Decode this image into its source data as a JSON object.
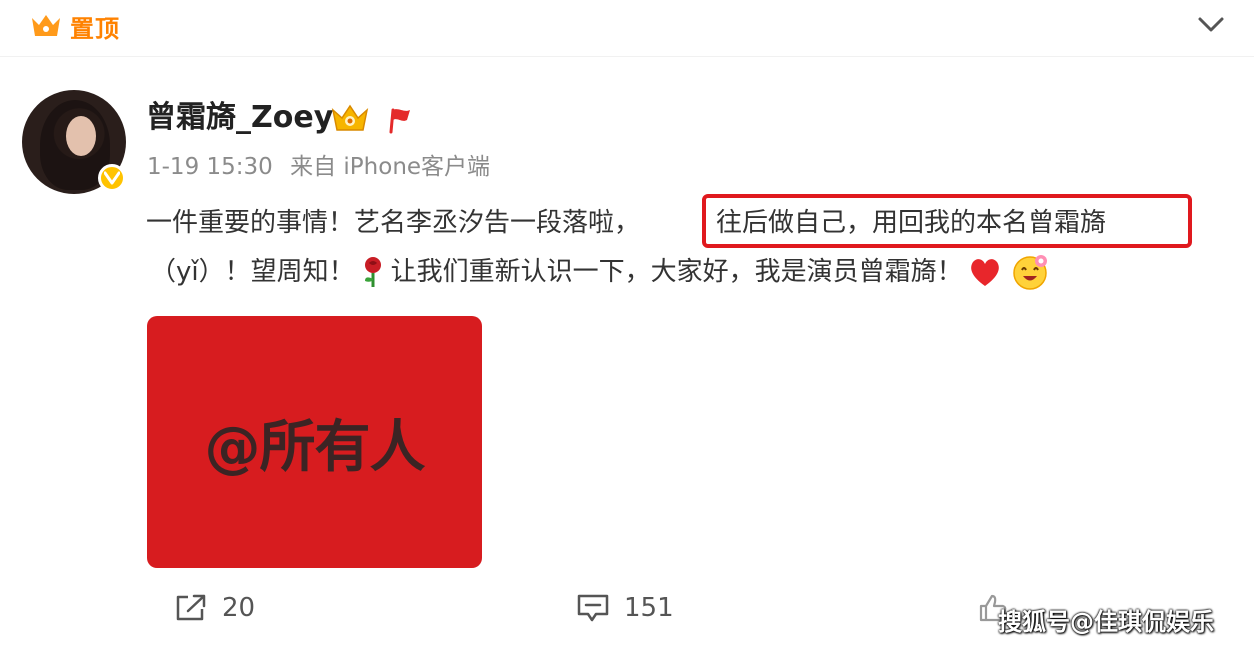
{
  "pinned": {
    "label": "置顶",
    "icon": "crown-icon",
    "color": "#ff8200"
  },
  "post": {
    "author": "曾霜旖_Zoey",
    "author_badges": [
      "crown-badge-icon",
      "red-flag-icon"
    ],
    "verified_color": "#ffc300",
    "time": "1-19 15:30",
    "source": "来自 iPhone客户端",
    "text_line1": "一件重要的事情！艺名李丞汐告一段落啦，",
    "text_highlighted": "往后做自己，用回我的本名曾霜旖",
    "text_line2_a": "（yǐ）！望周知！",
    "text_line2_b": "让我们重新认识一下，大家好，我是演员曾霜旖！",
    "highlight_color": "#e0191e",
    "image_card": {
      "text": "@所有人",
      "background": "#d71c1f"
    }
  },
  "actions": {
    "share_count": "20",
    "comment_count": "151",
    "like_count": "..."
  },
  "watermark": "搜狐号@佳琪侃娱乐"
}
